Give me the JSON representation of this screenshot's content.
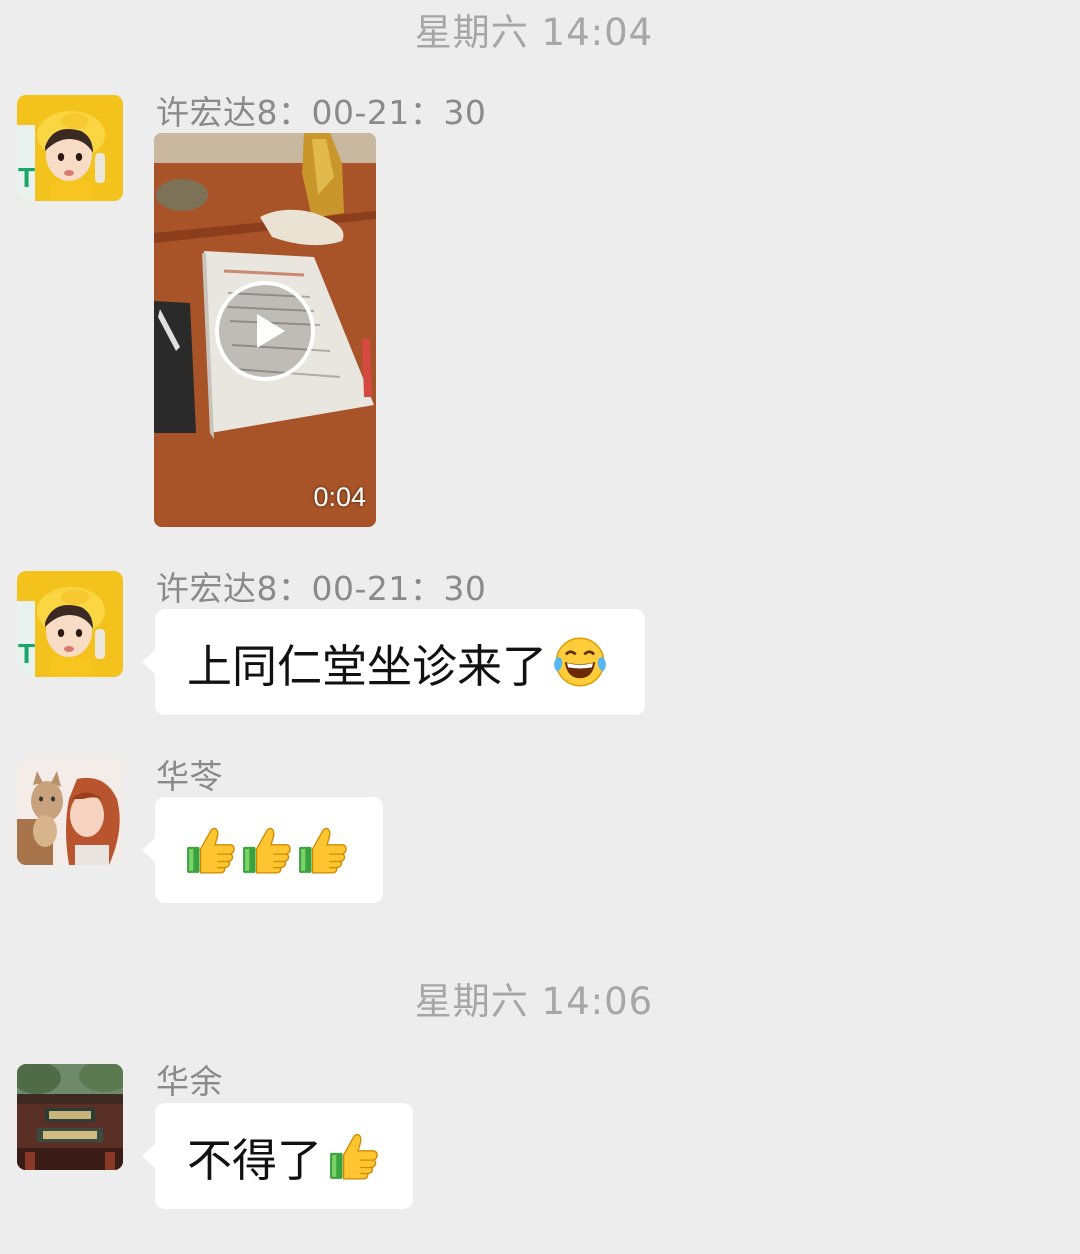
{
  "timestamps": [
    "星期六 14:04",
    "星期六 14:06"
  ],
  "messages": [
    {
      "sender": "许宏达8：00-21：30",
      "type": "video",
      "duration": "0:04",
      "avatar": "child-with-yellow-hat-avatar"
    },
    {
      "sender": "许宏达8：00-21：30",
      "type": "text",
      "text": "上同仁堂坐诊来了",
      "emoji": "tears-of-joy-icon",
      "avatar": "child-with-yellow-hat-avatar"
    },
    {
      "sender": "华苓",
      "type": "emoji",
      "emojis": [
        "thumbs-up-icon",
        "thumbs-up-icon",
        "thumbs-up-icon"
      ],
      "avatar": "woman-with-cat-avatar"
    },
    {
      "sender": "华余",
      "type": "text",
      "text": "不得了",
      "emoji": "thumbs-up-icon",
      "avatar": "building-gate-avatar"
    }
  ],
  "colors": {
    "background": "#ededed",
    "bubble": "#ffffff",
    "timestamp_text": "#a6a6a6",
    "sender_text": "#8a8a8a",
    "message_text": "#111111"
  }
}
